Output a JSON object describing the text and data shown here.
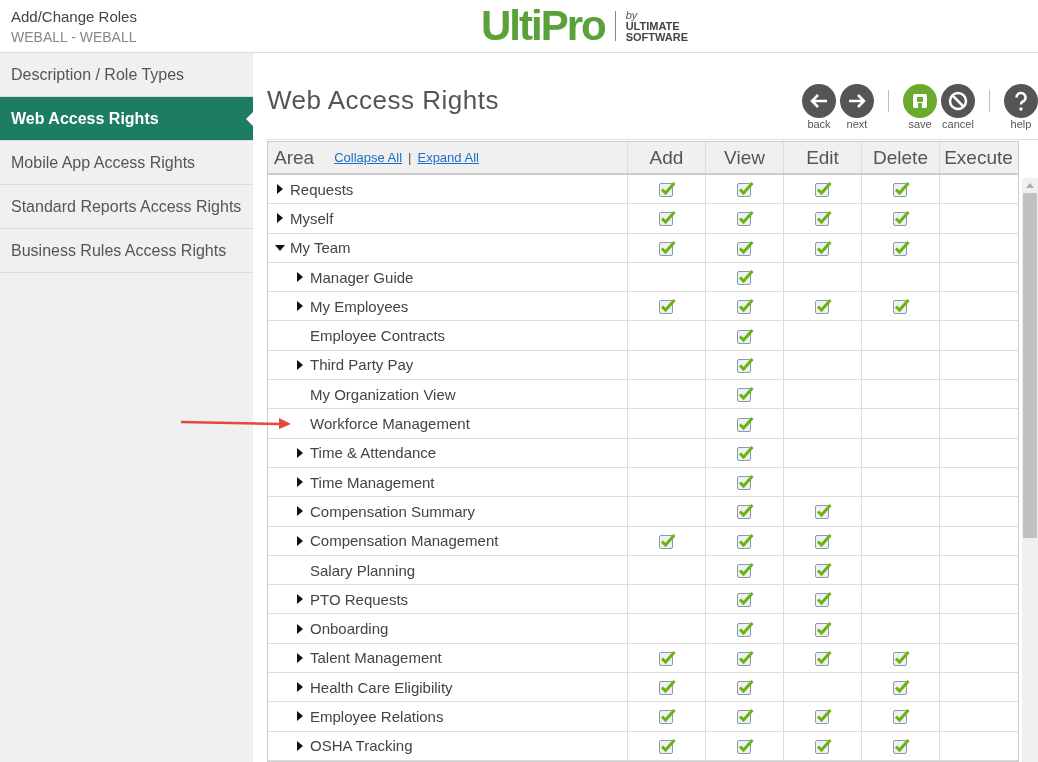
{
  "header": {
    "title": "Add/Change Roles",
    "subtitle": "WEBALL - WEBALL",
    "logo": "UltiPro",
    "logo_by": "by",
    "logo_company": [
      "ULTIMATE",
      "SOFTWARE"
    ]
  },
  "sidebar": {
    "items": [
      {
        "label": "Description / Role Types",
        "selected": false
      },
      {
        "label": "Web Access Rights",
        "selected": true
      },
      {
        "label": "Mobile App Access Rights",
        "selected": false
      },
      {
        "label": "Standard Reports Access Rights",
        "selected": false
      },
      {
        "label": "Business Rules Access Rights",
        "selected": false
      }
    ]
  },
  "page_title": "Web Access Rights",
  "toolbar": [
    {
      "kind": "back",
      "label": "back"
    },
    {
      "kind": "next",
      "label": "next"
    },
    {
      "kind": "save",
      "label": "save"
    },
    {
      "kind": "cancel",
      "label": "cancel"
    },
    {
      "kind": "help",
      "label": "help"
    }
  ],
  "table": {
    "area_header": "Area",
    "collapse_all": "Collapse All",
    "separator": "|",
    "expand_all": "Expand All",
    "columns": [
      "Add",
      "View",
      "Edit",
      "Delete",
      "Execute"
    ],
    "rows": [
      {
        "label": "Requests",
        "expanded": false,
        "checks": [
          true,
          true,
          true,
          true,
          false
        ]
      },
      {
        "label": "Myself",
        "expanded": false,
        "checks": [
          true,
          true,
          true,
          true,
          false
        ]
      },
      {
        "label": "My Team",
        "expanded": true,
        "checks": [
          true,
          true,
          true,
          true,
          false
        ],
        "children": [
          {
            "label": "Manager Guide",
            "expanded": false,
            "checks": [
              false,
              true,
              false,
              false,
              false
            ]
          },
          {
            "label": "My Employees",
            "expanded": false,
            "checks": [
              true,
              true,
              true,
              true,
              false
            ]
          },
          {
            "label": "Employee Contracts",
            "checks": [
              false,
              true,
              false,
              false,
              false
            ]
          },
          {
            "label": "Third Party Pay",
            "expanded": false,
            "checks": [
              false,
              true,
              false,
              false,
              false
            ]
          },
          {
            "label": "My Organization View",
            "checks": [
              false,
              true,
              false,
              false,
              false
            ]
          },
          {
            "label": "Workforce Management",
            "checks": [
              false,
              true,
              false,
              false,
              false
            ]
          },
          {
            "label": "Time & Attendance",
            "expanded": false,
            "checks": [
              false,
              true,
              false,
              false,
              false
            ]
          },
          {
            "label": "Time Management",
            "expanded": false,
            "checks": [
              false,
              true,
              false,
              false,
              false
            ]
          },
          {
            "label": "Compensation Summary",
            "expanded": false,
            "checks": [
              false,
              true,
              true,
              false,
              false
            ]
          },
          {
            "label": "Compensation Management",
            "expanded": false,
            "checks": [
              true,
              true,
              true,
              false,
              false
            ]
          },
          {
            "label": "Salary Planning",
            "checks": [
              false,
              true,
              true,
              false,
              false
            ]
          },
          {
            "label": "PTO Requests",
            "expanded": false,
            "checks": [
              false,
              true,
              true,
              false,
              false
            ]
          },
          {
            "label": "Onboarding",
            "expanded": false,
            "checks": [
              false,
              true,
              true,
              false,
              false
            ]
          },
          {
            "label": "Talent Management",
            "expanded": false,
            "checks": [
              true,
              true,
              true,
              true,
              false
            ]
          },
          {
            "label": "Health Care Eligibility",
            "expanded": false,
            "checks": [
              true,
              true,
              false,
              true,
              false
            ]
          },
          {
            "label": "Employee Relations",
            "expanded": false,
            "checks": [
              true,
              true,
              true,
              true,
              false
            ]
          },
          {
            "label": "OSHA Tracking",
            "expanded": false,
            "checks": [
              true,
              true,
              true,
              true,
              false
            ]
          }
        ]
      }
    ]
  }
}
